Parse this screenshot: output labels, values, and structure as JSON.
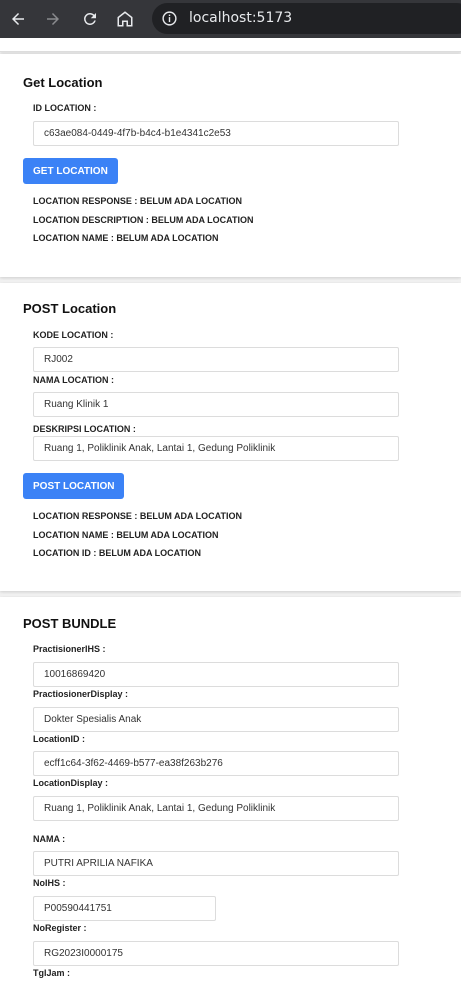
{
  "browser": {
    "url": "localhost:5173",
    "icons": [
      "back-icon",
      "forward-icon",
      "reload-icon",
      "home-icon",
      "info-icon"
    ]
  },
  "get_location": {
    "title": "Get Location",
    "id_label": "ID LOCATION :",
    "id_value": "c63ae084-0449-4f7b-b4c4-b1e4341c2e53",
    "button": "GET LOCATION",
    "responses": [
      "LOCATION RESPONSE : BELUM ADA LOCATION",
      "LOCATION DESCRIPTION : BELUM ADA LOCATION",
      "LOCATION NAME : BELUM ADA LOCATION"
    ]
  },
  "post_location": {
    "title": "POST Location",
    "kode_label": "KODE LOCATION :",
    "kode_value": "RJ002",
    "nama_label": "NAMA LOCATION :",
    "nama_value": "Ruang Klinik 1",
    "deskripsi_label": "DESKRIPSI LOCATION :",
    "deskripsi_value": "Ruang 1, Poliklinik Anak, Lantai 1, Gedung Poliklinik",
    "button": "POST LOCATION",
    "responses": [
      "LOCATION RESPONSE : BELUM ADA LOCATION",
      "LOCATION NAME : BELUM ADA LOCATION",
      "LOCATION ID : BELUM ADA LOCATION"
    ]
  },
  "post_bundle": {
    "title": "POST BUNDLE",
    "practitioner_ihs_label": "PractisionerIHS :",
    "practitioner_ihs_value": "10016869420",
    "practitioner_display_label": "PractiosionerDisplay :",
    "practitioner_display_value": "Dokter Spesialis Anak",
    "location_id_label": "LocationID :",
    "location_id_value": "ecff1c64-3f62-4469-b577-ea38f263b276",
    "location_display_label": "LocationDisplay :",
    "location_display_value": "Ruang 1, Poliklinik Anak, Lantai 1, Gedung Poliklinik",
    "nama_label": "NAMA :",
    "nama_value": "PUTRI APRILIA NAFIKA",
    "noihs_label": "NoIHS :",
    "noihs_value": "P00590441751",
    "noregister_label": "NoRegister :",
    "noregister_value": "RG2023I0000175",
    "tgljam_label": "TglJam :"
  },
  "colors": {
    "primary_button": "#3b82f6",
    "chrome_bg": "#35363a",
    "omnibox_bg": "#202124"
  }
}
